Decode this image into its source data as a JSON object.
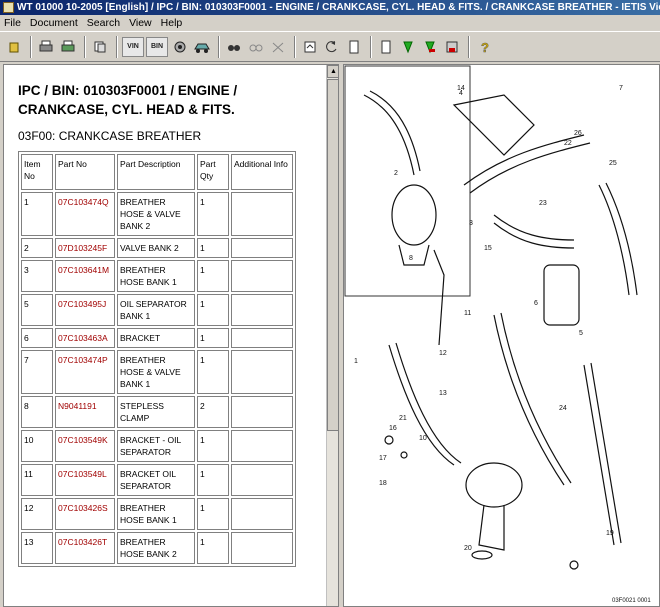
{
  "window": {
    "title": "WT 01000 10-2005 [English] / IPC / BIN: 010303F0001 - ENGINE / CRANKCASE, CYL. HEAD & FITS. / CRANKCASE BREATHER - IETIS Vie..."
  },
  "menu": [
    "File",
    "Document",
    "Search",
    "View",
    "Help"
  ],
  "toolbar": {
    "vin_label": "VIN",
    "bin_label": "BIN"
  },
  "document": {
    "title_line1": "IPC / BIN: 010303F0001 / ENGINE /",
    "title_line2": "CRANKCASE, CYL. HEAD & FITS.",
    "section": "03F00: CRANKCASE BREATHER",
    "headers": {
      "item": "Item No",
      "part_no": "Part No",
      "desc": "Part Description",
      "qty": "Part Qty",
      "info": "Additional Info"
    },
    "rows": [
      {
        "item": "1",
        "part_no": "07C103474Q",
        "desc": "BREATHER HOSE & VALVE BANK 2",
        "qty": "1",
        "info": ""
      },
      {
        "item": "2",
        "part_no": "07D103245F",
        "desc": "VALVE BANK 2",
        "qty": "1",
        "info": ""
      },
      {
        "item": "3",
        "part_no": "07C103641M",
        "desc": "BREATHER HOSE BANK 1",
        "qty": "1",
        "info": ""
      },
      {
        "item": "5",
        "part_no": "07C103495J",
        "desc": "OIL SEPARATOR BANK 1",
        "qty": "1",
        "info": ""
      },
      {
        "item": "6",
        "part_no": "07C103463A",
        "desc": "BRACKET",
        "qty": "1",
        "info": ""
      },
      {
        "item": "7",
        "part_no": "07C103474P",
        "desc": "BREATHER HOSE & VALVE BANK 1",
        "qty": "1",
        "info": ""
      },
      {
        "item": "8",
        "part_no": "N9041191",
        "desc": "STEPLESS CLAMP",
        "qty": "2",
        "info": ""
      },
      {
        "item": "10",
        "part_no": "07C103549K",
        "desc": "BRACKET - OIL SEPARATOR",
        "qty": "1",
        "info": ""
      },
      {
        "item": "11",
        "part_no": "07C103549L",
        "desc": "BRACKET OIL SEPARATOR",
        "qty": "1",
        "info": ""
      },
      {
        "item": "12",
        "part_no": "07C103426S",
        "desc": "BREATHER HOSE BANK 1",
        "qty": "1",
        "info": ""
      },
      {
        "item": "13",
        "part_no": "07C103426T",
        "desc": "BREATHER HOSE BANK 2",
        "qty": "1",
        "info": ""
      }
    ]
  },
  "diagram": {
    "callouts": [
      "1",
      "2",
      "3",
      "4",
      "5",
      "6",
      "7",
      "8",
      "10",
      "11",
      "12",
      "13",
      "14",
      "15",
      "16",
      "17",
      "18",
      "19",
      "20",
      "21",
      "22",
      "23",
      "24",
      "25",
      "26"
    ],
    "reference": "03F0021 0001"
  }
}
